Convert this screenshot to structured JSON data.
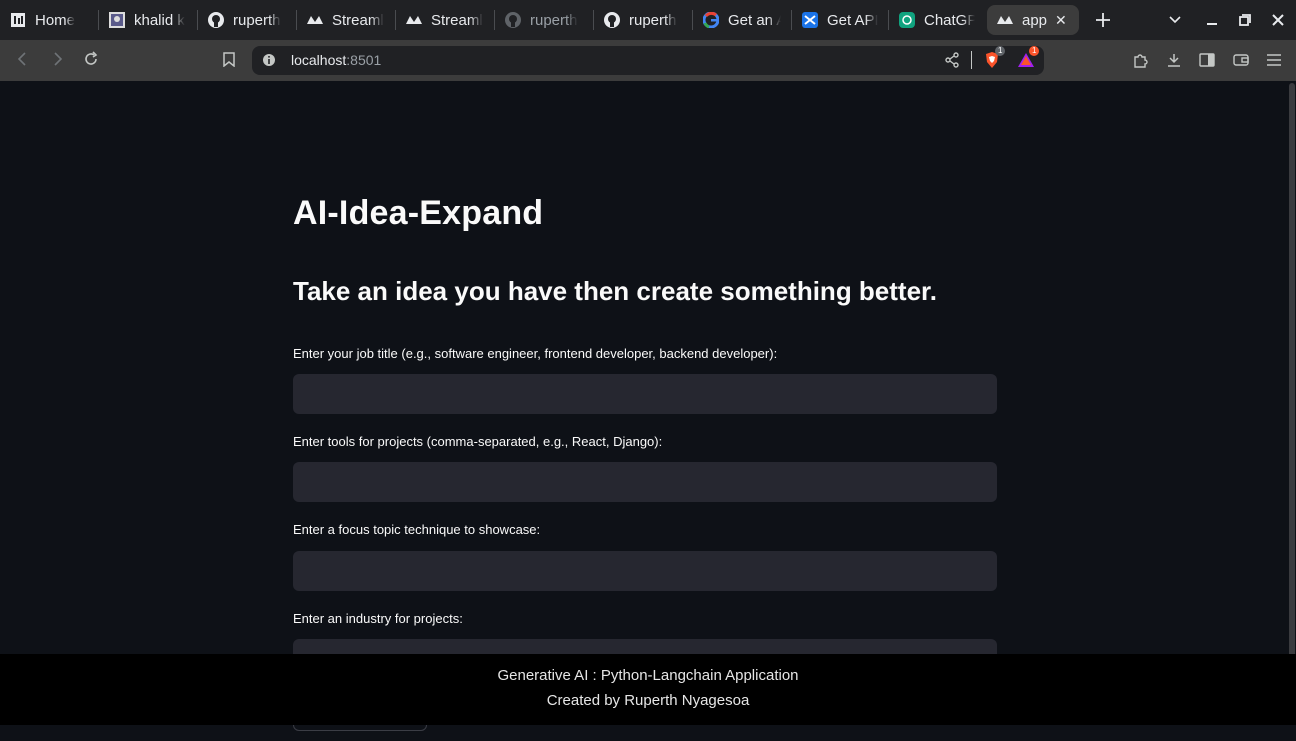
{
  "browser": {
    "tabs": [
      {
        "title": "Home",
        "favicon": "home-app-icon"
      },
      {
        "title": "khalid k",
        "favicon": "profile-image-icon"
      },
      {
        "title": "ruperth",
        "favicon": "github-icon"
      },
      {
        "title": "Streaml",
        "favicon": "streamlit-icon"
      },
      {
        "title": "Streaml",
        "favicon": "streamlit-icon"
      },
      {
        "title": "ruperth",
        "favicon": "github-icon"
      },
      {
        "title": "ruperth",
        "favicon": "github-icon"
      },
      {
        "title": "Get an A",
        "favicon": "google-icon"
      },
      {
        "title": "Get API",
        "favicon": "openai-api-icon"
      },
      {
        "title": "ChatGP",
        "favicon": "chatgpt-icon"
      },
      {
        "title": "app",
        "favicon": "streamlit-icon",
        "active": true
      }
    ],
    "address": {
      "host": "localhost",
      "port": ":8501"
    },
    "brave_shield_count": "1",
    "rewards_count": "1"
  },
  "app": {
    "title": "AI-Idea-Expand",
    "subtitle": "Take an idea you have then create something better.",
    "fields": [
      {
        "label": "Enter your job title (e.g., software engineer, frontend developer, backend developer):",
        "value": ""
      },
      {
        "label": "Enter tools for projects (comma-separated, e.g., React, Django):",
        "value": ""
      },
      {
        "label": "Enter a focus topic technique to showcase:",
        "value": ""
      },
      {
        "label": "Enter an industry for projects:",
        "value": ""
      }
    ],
    "footer": {
      "line1": "Generative AI : Python-Langchain Application",
      "line2": "Created by Ruperth Nyagesoa"
    }
  },
  "colors": {
    "page_bg": "#0e1117",
    "input_bg": "#262730",
    "tabstrip_bg": "#202124",
    "toolbar_bg": "#3c3c3c",
    "footer_bg": "#000000",
    "brave_orange": "#fb542b"
  }
}
